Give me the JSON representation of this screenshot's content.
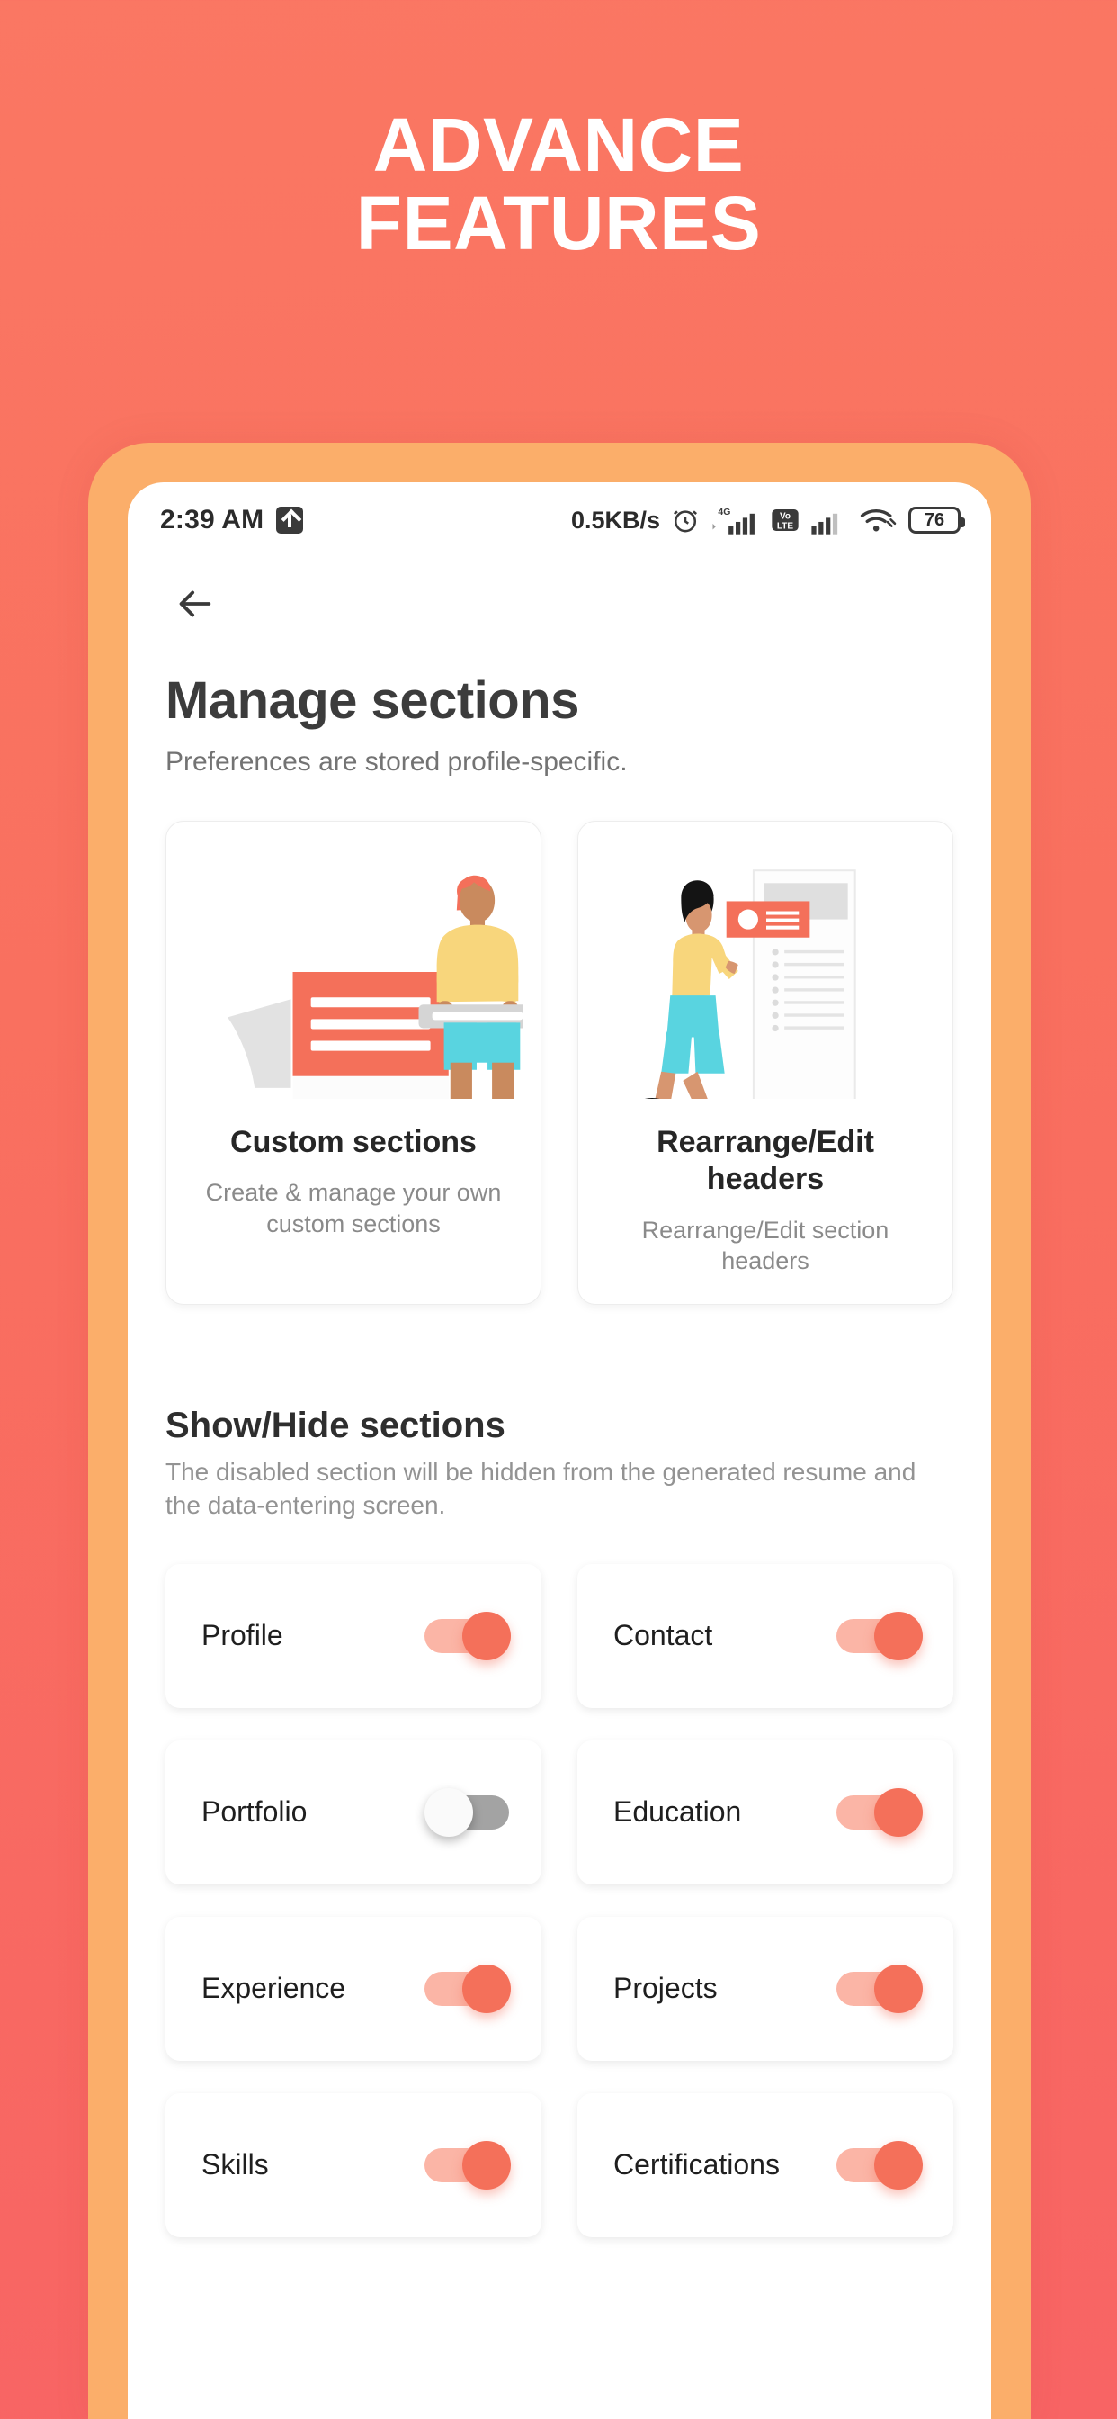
{
  "promo": {
    "line1": "ADVANCE",
    "line2": "FEATURES",
    "background_color": "#F9705F",
    "frame_color": "#FBAE6A"
  },
  "statusbar": {
    "time": "2:39 AM",
    "upload_icon": "upload-arrow-icon",
    "network_speed": "0.5KB/s",
    "alarm_icon": "alarm-clock-icon",
    "network_label": "4G",
    "volte_label_top": "Vo",
    "volte_label_bottom": "LTE",
    "wifi_icon": "wifi-icon",
    "battery_level": "76"
  },
  "appbar": {
    "back_icon": "back-arrow-icon"
  },
  "page": {
    "title": "Manage sections",
    "subtitle": "Preferences are stored profile-specific."
  },
  "feature_cards": [
    {
      "title": "Custom sections",
      "desc": "Create & manage your own custom sections",
      "art": "person-holding-document-illustration"
    },
    {
      "title": "Rearrange/Edit headers",
      "desc": "Rearrange/Edit section headers",
      "art": "person-pushing-header-card-illustration"
    }
  ],
  "show_hide": {
    "heading": "Show/Hide sections",
    "description": "The disabled section will be hidden from the generated resume and the data-entering screen.",
    "toggles": [
      {
        "label": "Profile",
        "state": "on"
      },
      {
        "label": "Contact",
        "state": "on"
      },
      {
        "label": "Portfolio",
        "state": "off"
      },
      {
        "label": "Education",
        "state": "on"
      },
      {
        "label": "Experience",
        "state": "on"
      },
      {
        "label": "Projects",
        "state": "on"
      },
      {
        "label": "Skills",
        "state": "on"
      },
      {
        "label": "Certifications",
        "state": "on"
      }
    ]
  },
  "colors": {
    "accent": "#F4705A",
    "accent_light": "#FBB5A6",
    "frame": "#FBAE6A",
    "bg": "#F9705F"
  }
}
